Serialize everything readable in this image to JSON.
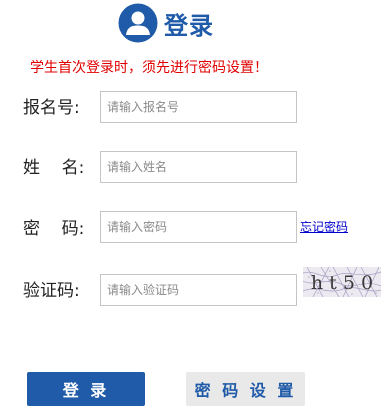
{
  "colors": {
    "brand_blue": "#1f5ba8",
    "notice_red": "#e00000",
    "link_blue": "#0000cc",
    "button_gray": "#e9e9e9"
  },
  "header": {
    "icon": "user-icon",
    "title": "登录"
  },
  "notice": "学生首次登录时，须先进行密码设置！",
  "form": {
    "registration_number": {
      "label": "报名号:",
      "value": "",
      "placeholder": "请输入报名号"
    },
    "name": {
      "label": "姓    名:",
      "value": "",
      "placeholder": "请输入姓名"
    },
    "password": {
      "label": "密    码:",
      "value": "",
      "placeholder": "请输入密码",
      "forgot_link": "忘记密码"
    },
    "captcha": {
      "label": "验证码:",
      "value": "",
      "placeholder": "请输入验证码",
      "image_text": "h t 5 0"
    }
  },
  "buttons": {
    "login": "登 录",
    "set_password": "密 码 设 置"
  }
}
